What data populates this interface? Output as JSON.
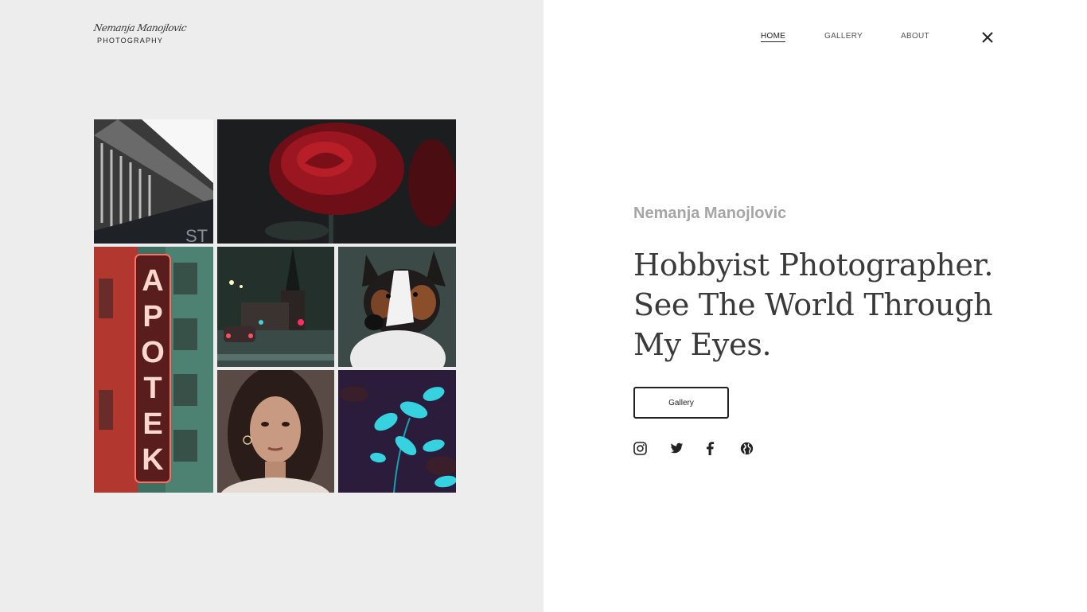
{
  "logo": {
    "script_text": "Nemanja Manojlovic",
    "subtitle": "PHOTOGRAPHY"
  },
  "nav": {
    "items": [
      {
        "label": "HOME",
        "active": true
      },
      {
        "label": "GALLERY",
        "active": false
      },
      {
        "label": "ABOUT",
        "active": false
      }
    ],
    "close_icon": "close-icon"
  },
  "gallery": {
    "tiles": [
      {
        "name": "architecture-photo",
        "subject": "building facade"
      },
      {
        "name": "rose-photo",
        "subject": "red rose"
      },
      {
        "name": "apotek-sign-photo",
        "subject": "neon APOTEK sign"
      },
      {
        "name": "night-church-photo",
        "subject": "church at night"
      },
      {
        "name": "dog-photo",
        "subject": "dog portrait"
      },
      {
        "name": "woman-portrait-photo",
        "subject": "portrait"
      },
      {
        "name": "teal-leaves-photo",
        "subject": "leaves"
      }
    ]
  },
  "hero": {
    "author": "Nemanja Manojlovic",
    "headline_line1": "Hobbyist Photographer.",
    "headline_line2": "See The World Through",
    "headline_line3": "My Eyes.",
    "button_label": "Gallery"
  },
  "social": [
    "instagram-icon",
    "twitter-icon",
    "facebook-icon",
    "globe-icon"
  ],
  "colors": {
    "left_panel_bg": "#ededed",
    "author": "#a6a6a6",
    "headline": "#3a3a3a"
  }
}
